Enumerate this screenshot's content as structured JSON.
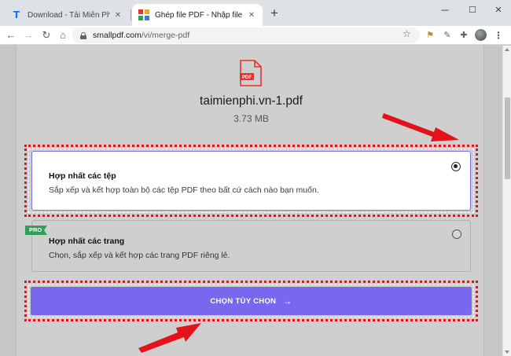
{
  "browser": {
    "tabs": [
      {
        "title": "Download - Tải Miễn Phí VN - Ph",
        "active": false
      },
      {
        "title": "Ghép file PDF - Nhập file PDF trự",
        "active": true
      }
    ],
    "new_tab": "+",
    "window_controls": {
      "minimize": "─",
      "maximize": "☐",
      "close": "✕"
    },
    "url_host": "smallpdf.com",
    "url_path": "/vi/merge-pdf"
  },
  "file": {
    "icon_label": "PDF",
    "name": "taimienphi.vn-1.pdf",
    "size": "3.73 MB"
  },
  "options": [
    {
      "title": "Hợp nhất các tệp",
      "description": "Sắp xếp và kết hợp toàn bộ các tệp PDF theo bất cứ cách nào bạn muốn.",
      "selected": true
    },
    {
      "title": "Hợp nhất các trang",
      "description": "Chọn, sắp xếp và kết hợp các trang PDF riêng lẻ.",
      "selected": false,
      "badge": "PRO"
    }
  ],
  "cta": {
    "label": "CHỌN TÙY CHỌN",
    "arrow": "→"
  },
  "colors": {
    "accent": "#7768ee",
    "pro_badge": "#2ea05a",
    "annotation_red": "#e3131b",
    "pdf_red": "#e5322d"
  }
}
